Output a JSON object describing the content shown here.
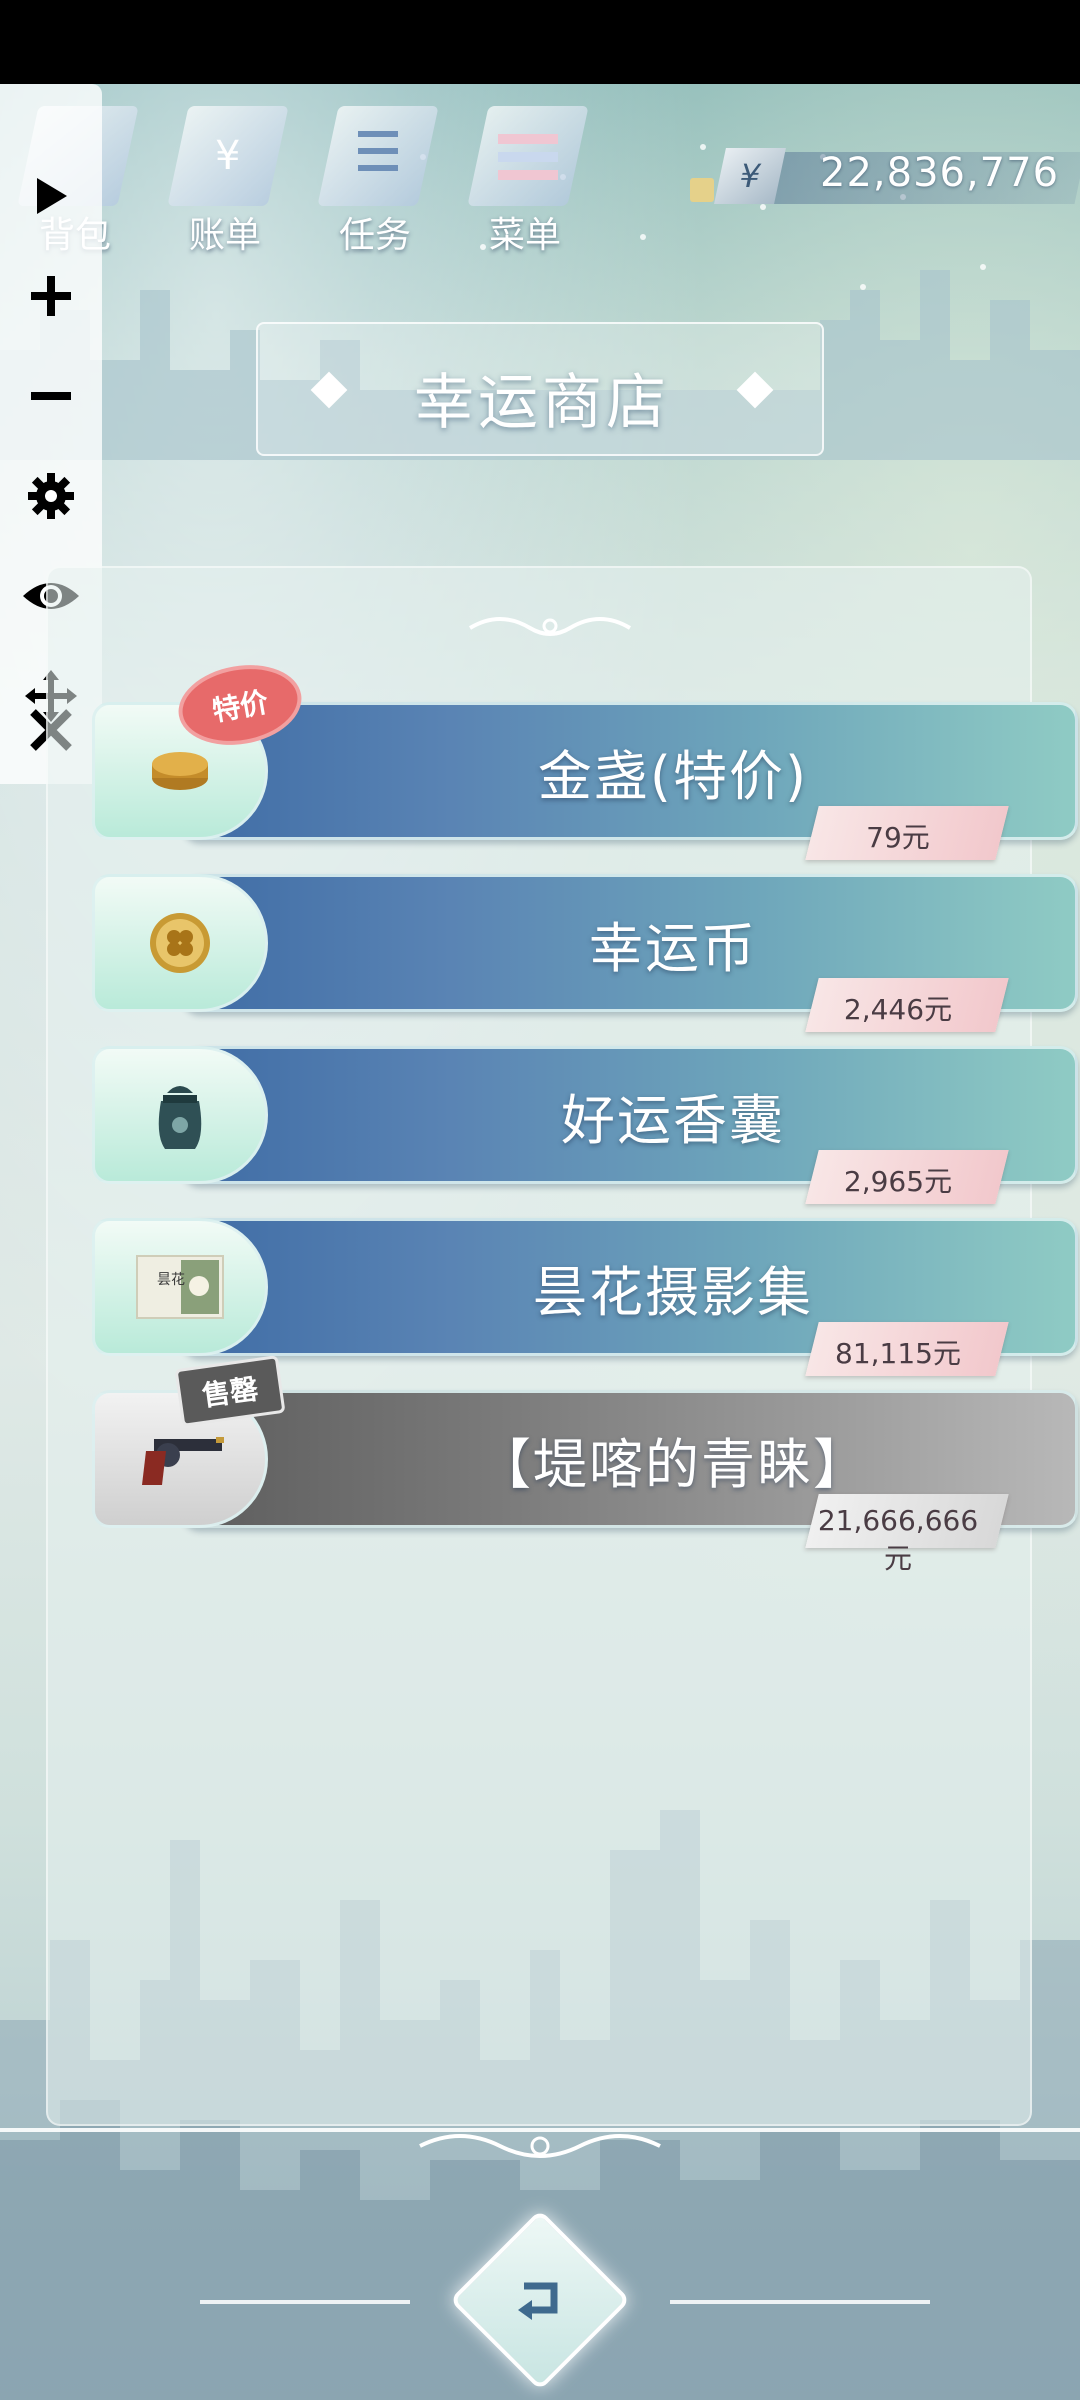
{
  "top_nav": {
    "items": [
      {
        "label": "背包",
        "icon": "bag-icon"
      },
      {
        "label": "账单",
        "icon": "bill-icon"
      },
      {
        "label": "任务",
        "icon": "task-icon"
      },
      {
        "label": "菜单",
        "icon": "menu-icon"
      }
    ],
    "currency_symbol": "¥",
    "balance": "22,836,776"
  },
  "toolbar": {
    "items": [
      "play-icon",
      "plus-icon",
      "minus-icon",
      "gear-icon",
      "eye-icon",
      "move-icon",
      "close-icon"
    ]
  },
  "shop": {
    "title": "幸运商店",
    "items": [
      {
        "name": "金盏(特价)",
        "price": "79元",
        "badge": "特价",
        "icon": "gold-coin-icon",
        "state": "available"
      },
      {
        "name": "幸运币",
        "price": "2,446元",
        "badge": "",
        "icon": "clover-coin-icon",
        "state": "available"
      },
      {
        "name": "好运香囊",
        "price": "2,965元",
        "badge": "",
        "icon": "sachet-icon",
        "state": "available"
      },
      {
        "name": "昙花摄影集",
        "price": "81,115元",
        "badge": "",
        "icon": "photo-album-icon",
        "state": "available"
      },
      {
        "name": "【堤喀的青睐】",
        "price": "21,666,666元",
        "badge": "售罄",
        "icon": "revolver-icon",
        "state": "sold-out"
      }
    ]
  },
  "colors": {
    "item_blue": "#5a84b4",
    "item_teal": "#8fcbc4",
    "sale_badge": "#e76a6a",
    "sold_badge": "#5a5a5a",
    "price_tag": "#f2c8cc"
  },
  "album_icon_text": "昙花"
}
